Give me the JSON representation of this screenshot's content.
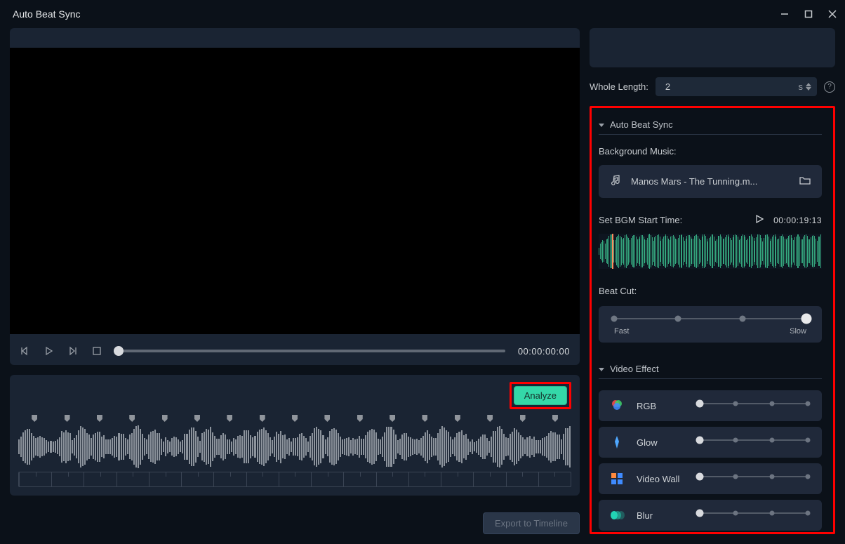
{
  "window": {
    "title": "Auto Beat Sync"
  },
  "transport": {
    "timecode": "00:00:00:00"
  },
  "timeline": {
    "analyze_label": "Analyze",
    "export_label": "Export to Timeline"
  },
  "whole_length": {
    "label": "Whole Length:",
    "value": "2",
    "unit": "s"
  },
  "sections": {
    "auto_beat_sync": {
      "title": "Auto Beat Sync",
      "bg_music_label": "Background Music:",
      "music_file": "Manos Mars - The Tunning.m...",
      "set_bgm_label": "Set BGM Start Time:",
      "bgm_time": "00:00:19:13",
      "beat_cut_label": "Beat Cut:",
      "beat_cut_fast": "Fast",
      "beat_cut_slow": "Slow",
      "beat_cut_steps": 4,
      "beat_cut_value": 3
    },
    "video_effect": {
      "title": "Video Effect",
      "effects": [
        {
          "name": "RGB",
          "value": 0,
          "steps": 4
        },
        {
          "name": "Glow",
          "value": 0,
          "steps": 4
        },
        {
          "name": "Video Wall",
          "value": 0,
          "steps": 4
        },
        {
          "name": "Blur",
          "value": 0,
          "steps": 4
        }
      ]
    }
  }
}
